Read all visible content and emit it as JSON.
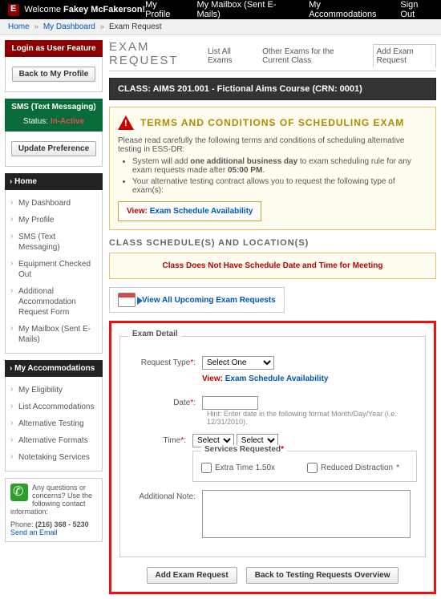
{
  "topbar": {
    "welcome_prefix": "Welcome ",
    "user_name": "Fakey McFakerson!",
    "profile": "My Profile",
    "mailbox": "My Mailbox (Sent E-Mails)",
    "accommodations": "My Accommodations",
    "signout": "Sign Out"
  },
  "crumbs": {
    "home": "Home",
    "dash": "My Dashboard",
    "current": "Exam Request"
  },
  "side": {
    "login_title": "Login as User Feature",
    "back_btn": "Back to My Profile",
    "sms_title": "SMS (Text Messaging)",
    "status_label": "Status:",
    "status_value": "In-Active",
    "update_btn": "Update Preference",
    "home_title": "Home",
    "home_items": [
      "My Dashboard",
      "My Profile",
      "SMS (Text Messaging)",
      "Equipment Checked Out",
      "Additional Accommodation Request Form",
      "My Mailbox (Sent E-Mails)"
    ],
    "acc_title": "My Accommodations",
    "acc_items": [
      "My Eligibility",
      "List Accommodations",
      "Alternative Testing",
      "Alternative Formats",
      "Notetaking Services"
    ],
    "contact_q": "Any questions or concerns? Use the following contact information:",
    "phone_label": "Phone:",
    "phone": "(216) 368 - 5230",
    "email_link": "Send an Email"
  },
  "main": {
    "title": "EXAM REQUEST",
    "tabs": {
      "list": "List All Exams",
      "other": "Other Exams for the Current Class",
      "add": "Add Exam Request"
    },
    "classbar": "CLASS: AIMS 201.001 - Fictional Aims Course (CRN: 0001)",
    "terms_title": "TERMS AND CONDITIONS OF SCHEDULING EXAM",
    "terms_intro": "Please read carefully the following terms and conditions of scheduling alternative testing in ESS-DR:",
    "terms_items": [
      "System will add one additional business day to exam scheduling rule for any exam requests made after 05:00 PM.",
      "Your alternative testing contract allows you to request the following type of exam(s):"
    ],
    "view_label": "View:",
    "view_link": "Exam Schedule Availability",
    "sched_title": "CLASS SCHEDULE(S) AND LOCATION(S)",
    "nosched": "Class Does Not Have Schedule Date and Time for Meeting",
    "upcoming_link": "View All Upcoming Exam Requests",
    "detail_legend": "Exam Detail",
    "labels": {
      "request_type": "Request Type",
      "date": "Date",
      "time": "Time",
      "note": "Additional Note:",
      "services": "Services Requested"
    },
    "select_one": "Select One",
    "select": "Select",
    "date_hint": "Hint: Enter date in the following format Month/Day/Year (i.e. 12/31/2010).",
    "svc1": "Extra Time 1.50x",
    "svc2": "Reduced Distraction",
    "btn_add": "Add Exam Request",
    "btn_back": "Back to Testing Requests Overview"
  }
}
